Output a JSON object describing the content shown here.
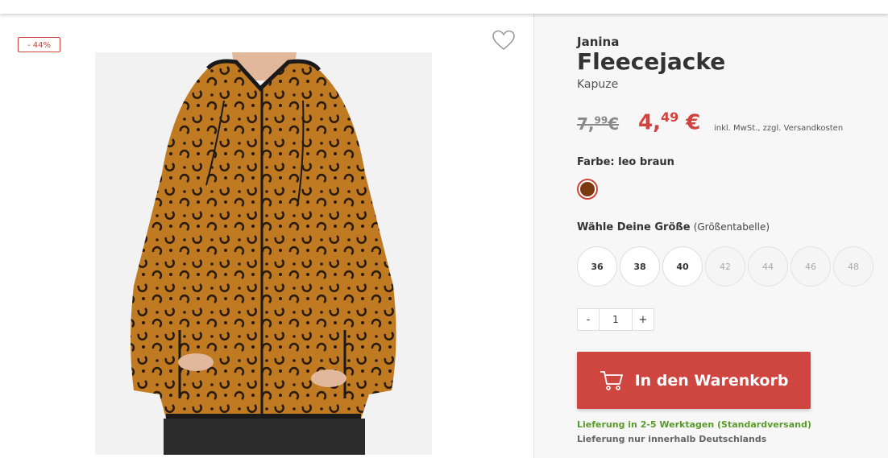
{
  "product": {
    "discount_badge": "- 44%",
    "brand": "Janina",
    "title": "Fleecejacke",
    "subtitle": "Kapuze",
    "old_price_main": "7,",
    "old_price_cents": "99",
    "old_price_currency": "€",
    "new_price_main": "4,",
    "new_price_cents": "49",
    "new_price_currency": "€",
    "tax_note": "inkl. MwSt., zzgl. Versandkosten"
  },
  "color": {
    "label": "Farbe: leo braun",
    "swatch_color": "#7a3a10",
    "accent": "#d0433e"
  },
  "size": {
    "label": "Wähle Deine Größe",
    "chart_link": "(Größentabelle)",
    "options": [
      {
        "value": "36",
        "available": true
      },
      {
        "value": "38",
        "available": true
      },
      {
        "value": "40",
        "available": true
      },
      {
        "value": "42",
        "available": false
      },
      {
        "value": "44",
        "available": false
      },
      {
        "value": "46",
        "available": false
      },
      {
        "value": "48",
        "available": false
      }
    ]
  },
  "quantity": {
    "minus": "-",
    "value": "1",
    "plus": "+"
  },
  "cart_button": {
    "label": "In den Warenkorb",
    "color": "#cf4540"
  },
  "delivery": {
    "time": "Lieferung in 2-5 Werktagen (Standardversand)",
    "region": "Lieferung nur innerhalb Deutschlands"
  },
  "icons": {
    "wishlist": "heart-icon",
    "cart": "shopping-cart-icon"
  }
}
